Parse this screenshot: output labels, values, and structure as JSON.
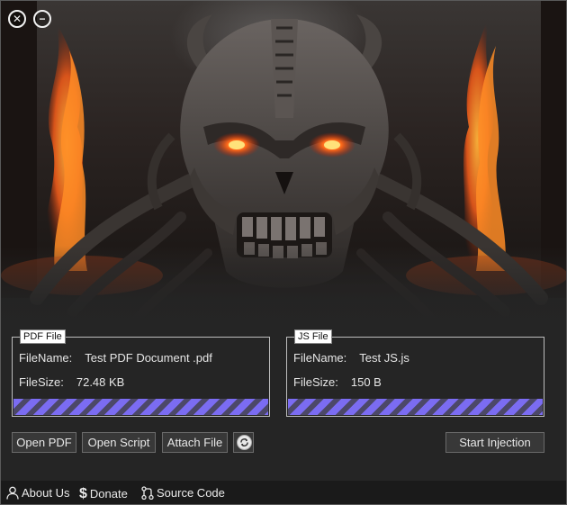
{
  "window": {
    "close_icon": "close-circle-icon",
    "minimize_icon": "minimize-circle-icon"
  },
  "pdf_group": {
    "title": "PDF File",
    "filename_label": "FileName:",
    "filename_value": "Test PDF Document .pdf",
    "filesize_label": "FileSize:",
    "filesize_value": "72.48 KB",
    "progress": 1.0
  },
  "js_group": {
    "title": "JS File",
    "filename_label": "FileName:",
    "filename_value": "Test JS.js",
    "filesize_label": "FileSize:",
    "filesize_value": "150 B",
    "progress": 1.0
  },
  "buttons": {
    "open_pdf": "Open PDF",
    "open_script": "Open Script",
    "attach_file": "Attach File",
    "refresh_icon": "refresh-icon",
    "start_injection": "Start Injection"
  },
  "footer": {
    "about": "About Us",
    "donate": "Donate",
    "source": "Source Code"
  },
  "colors": {
    "background": "#252525",
    "progress_stripe": "#7b6cf2",
    "footer": "#1a1a1a"
  }
}
